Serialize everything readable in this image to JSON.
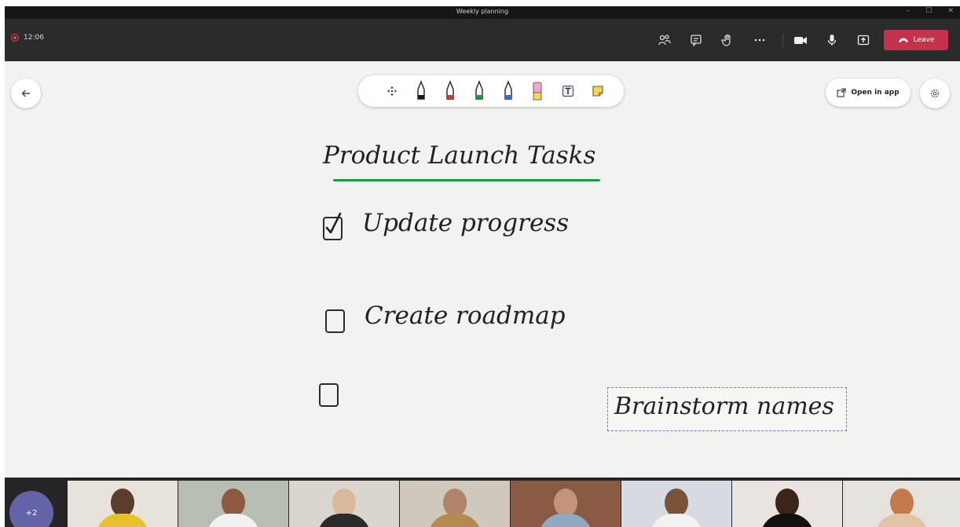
{
  "window": {
    "title": "Weekly planning",
    "controls": [
      "–",
      "☐",
      "✕"
    ]
  },
  "meeting": {
    "timer": "12:06",
    "leave_label": "Leave"
  },
  "whiteboard": {
    "open_in_app_label": "Open in app",
    "title": "Product Launch Tasks",
    "tasks": [
      {
        "label": "Update progress",
        "checked": true
      },
      {
        "label": "Create roadmap",
        "checked": false
      },
      {
        "label": "",
        "checked": false
      }
    ],
    "note": "Brainstorm names",
    "pen_colors": [
      "#1a1a1a",
      "#d13438",
      "#1e9a3e",
      "#2f6fd6"
    ],
    "highlighter_color": "#f3a6d3",
    "accent_underline": "#1e9a3e"
  },
  "participants": {
    "overflow_label": "+2",
    "count_visible": 8
  },
  "colors": {
    "leave": "#c4314b",
    "overflow": "#6264a7",
    "titlebar": "#161616",
    "meetbar": "#2b2b2b"
  }
}
